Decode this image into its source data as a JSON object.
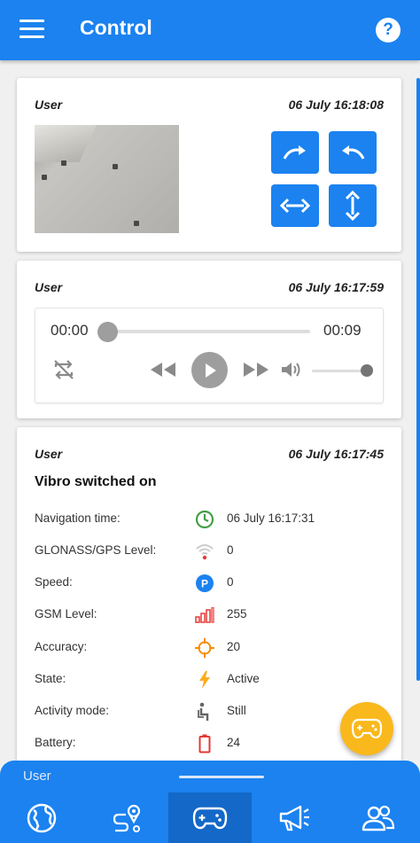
{
  "appbar": {
    "title": "Control",
    "menu_icon": "hamburger-menu-icon",
    "help_icon": "help-icon",
    "help_glyph": "?"
  },
  "colors": {
    "primary": "#1b82f0",
    "fab": "#f9b81c",
    "card_bg": "#ffffff"
  },
  "photo_card": {
    "user": "User",
    "time": "06 July 16:18:08",
    "buttons": [
      "rotate-clockwise",
      "rotate-counterclockwise",
      "flip-horizontal",
      "flip-vertical"
    ]
  },
  "audio_card": {
    "user": "User",
    "time": "06 July 16:17:59",
    "player": {
      "current": "00:00",
      "duration": "00:09",
      "progress": 0,
      "volume": 1.0
    }
  },
  "event_card": {
    "user": "User",
    "time": "06 July 16:17:45",
    "title": "Vibro switched on",
    "rows": [
      {
        "label": "Navigation time:",
        "icon": "clock-icon",
        "value": "06 July 16:17:31"
      },
      {
        "label": "GLONASS/GPS Level:",
        "icon": "wifi-signal-icon",
        "value": "0"
      },
      {
        "label": "Speed:",
        "icon": "speed-badge-icon",
        "value": "0"
      },
      {
        "label": "GSM Level:",
        "icon": "signal-bars-icon",
        "value": "255"
      },
      {
        "label": "Accuracy:",
        "icon": "crosshair-icon",
        "value": "20"
      },
      {
        "label": "State:",
        "icon": "lightning-icon",
        "value": "Active"
      },
      {
        "label": "Activity mode:",
        "icon": "person-sitting-icon",
        "value": "Still"
      },
      {
        "label": "Battery:",
        "icon": "battery-icon",
        "value": "24"
      }
    ]
  },
  "fab": {
    "icon": "gamepad-icon"
  },
  "sheet": {
    "label": "User"
  },
  "bottom_nav": [
    {
      "icon": "globe-icon",
      "active": false
    },
    {
      "icon": "route-icon",
      "active": false
    },
    {
      "icon": "gamepad-icon",
      "active": true
    },
    {
      "icon": "megaphone-icon",
      "active": false
    },
    {
      "icon": "users-icon",
      "active": false
    }
  ]
}
